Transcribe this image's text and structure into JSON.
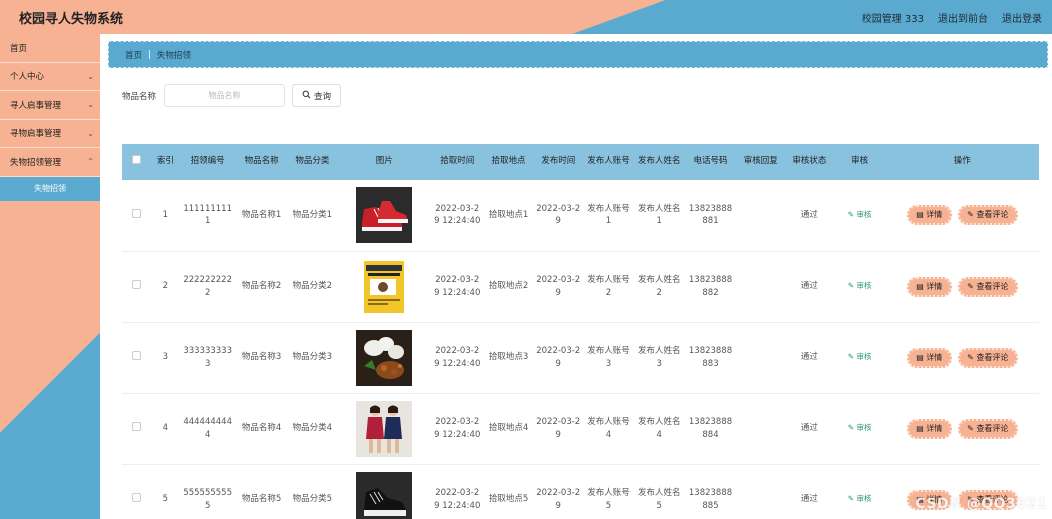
{
  "header": {
    "title": "校园寻人失物系统",
    "user_label": "校园管理 333",
    "to_frontend": "退出到前台",
    "logout": "退出登录"
  },
  "sidebar": {
    "items": [
      {
        "label": "首页",
        "has_chevron": false
      },
      {
        "label": "个人中心",
        "has_chevron": true
      },
      {
        "label": "寻人启事管理",
        "has_chevron": true
      },
      {
        "label": "寻物启事管理",
        "has_chevron": true
      },
      {
        "label": "失物招领管理",
        "has_chevron": true
      }
    ],
    "active_sub": "失物招领"
  },
  "breadcrumb": {
    "home": "首页",
    "separator": "|",
    "current": "失物招领"
  },
  "search": {
    "label": "物品名称",
    "placeholder": "物品名称",
    "button": "查询"
  },
  "table": {
    "headers": [
      "索引",
      "招领编号",
      "物品名称",
      "物品分类",
      "图片",
      "拾取时间",
      "拾取地点",
      "发布时间",
      "发布人账号",
      "发布人姓名",
      "电话号码",
      "审核回复",
      "审核状态",
      "审核",
      "操作"
    ],
    "audit_text": "审核",
    "detail_text": "详情",
    "view_comment_text": "查看评论",
    "rows": [
      {
        "index": "1",
        "code": "1111111111",
        "name": "物品名称1",
        "category": "物品分类1",
        "photo": "red-sneakers",
        "pick_time": "2022-03-29 12:24:40",
        "place": "拾取地点1",
        "pub_time": "2022-03-29",
        "account": "发布人账号1",
        "publisher": "发布人姓名1",
        "phone": "13823888881",
        "reply": "",
        "status": "通过"
      },
      {
        "index": "2",
        "code": "2222222222",
        "name": "物品名称2",
        "category": "物品分类2",
        "photo": "yellow-book",
        "pick_time": "2022-03-29 12:24:40",
        "place": "拾取地点2",
        "pub_time": "2022-03-29",
        "account": "发布人账号2",
        "publisher": "发布人姓名2",
        "phone": "13823888882",
        "reply": "",
        "status": "通过"
      },
      {
        "index": "3",
        "code": "3333333333",
        "name": "物品名称3",
        "category": "物品分类3",
        "photo": "food-plate",
        "pick_time": "2022-03-29 12:24:40",
        "place": "拾取地点3",
        "pub_time": "2022-03-29",
        "account": "发布人账号3",
        "publisher": "发布人姓名3",
        "phone": "13823888883",
        "reply": "",
        "status": "通过"
      },
      {
        "index": "4",
        "code": "4444444444",
        "name": "物品名称4",
        "category": "物品分类4",
        "photo": "two-women",
        "pick_time": "2022-03-29 12:24:40",
        "place": "拾取地点4",
        "pub_time": "2022-03-29",
        "account": "发布人账号4",
        "publisher": "发布人姓名4",
        "phone": "13823888884",
        "reply": "",
        "status": "通过"
      },
      {
        "index": "5",
        "code": "5555555555",
        "name": "物品名称5",
        "category": "物品分类5",
        "photo": "black-sneakers",
        "pick_time": "2022-03-29 12:24:40",
        "place": "拾取地点5",
        "pub_time": "2022-03-29",
        "account": "发布人账号5",
        "publisher": "发布人姓名5",
        "phone": "13823888885",
        "reply": "",
        "status": "通过"
      }
    ]
  },
  "watermark": "CSDN @QQ3021",
  "colors": {
    "accent_peach": "#f7b293",
    "accent_blue": "#5aaad0",
    "header_row": "#89c2de",
    "audit_green": "#2b9a66"
  }
}
